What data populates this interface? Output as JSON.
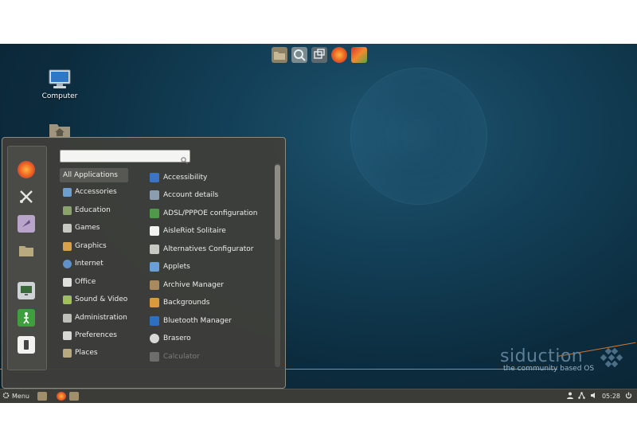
{
  "desktop": {
    "icons": [
      {
        "label": "Computer"
      }
    ]
  },
  "branding": {
    "name": "siduction",
    "tagline": "the community based OS"
  },
  "menu": {
    "search": {
      "value": "",
      "placeholder": ""
    },
    "categories": [
      {
        "label": "All Applications",
        "selected": true
      },
      {
        "label": "Accessories"
      },
      {
        "label": "Education"
      },
      {
        "label": "Games"
      },
      {
        "label": "Graphics"
      },
      {
        "label": "Internet"
      },
      {
        "label": "Office"
      },
      {
        "label": "Sound & Video"
      },
      {
        "label": "Administration"
      },
      {
        "label": "Preferences"
      },
      {
        "label": "Places"
      }
    ],
    "applications": [
      {
        "label": "Accessibility"
      },
      {
        "label": "Account details"
      },
      {
        "label": "ADSL/PPPOE configuration"
      },
      {
        "label": "AisleRiot Solitaire"
      },
      {
        "label": "Alternatives Configurator"
      },
      {
        "label": "Applets"
      },
      {
        "label": "Archive Manager"
      },
      {
        "label": "Backgrounds"
      },
      {
        "label": "Bluetooth Manager"
      },
      {
        "label": "Brasero"
      },
      {
        "label": "Calculator"
      }
    ]
  },
  "taskbar": {
    "menu_label": "Menu",
    "clock": "05:28"
  },
  "colors": {
    "accent_line": "#d0752a",
    "panel": "#3b3b38",
    "menu_bg": "#3e3e3a"
  }
}
